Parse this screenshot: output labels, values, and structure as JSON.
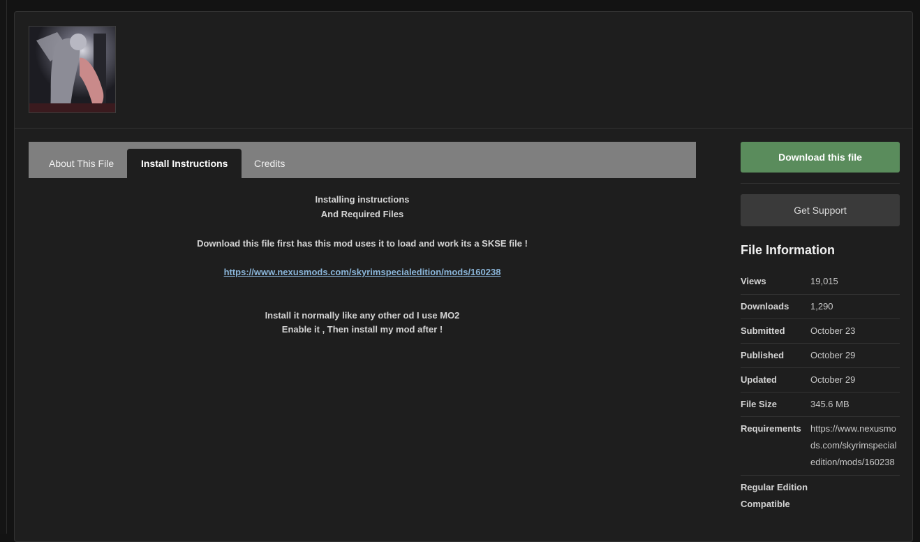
{
  "tabs": {
    "about": "About This File",
    "install": "Install Instructions",
    "credits": "Credits"
  },
  "content": {
    "line1": "Installing instructions",
    "line2": "And Required Files",
    "line3": "Download this file first has this mod uses it to load and work its a SKSE file !",
    "link": "https://www.nexusmods.com/skyrimspecialedition/mods/160238",
    "line4": "Install it normally like any other od  I use MO2",
    "line5": "Enable it , Then install my mod after !"
  },
  "sidebar": {
    "download_label": "Download this file",
    "support_label": "Get Support",
    "file_info_title": "File Information",
    "rows": [
      {
        "key": "Views",
        "value": "19,015"
      },
      {
        "key": "Downloads",
        "value": "1,290"
      },
      {
        "key": "Submitted",
        "value": "October 23"
      },
      {
        "key": "Published",
        "value": "October 29"
      },
      {
        "key": "Updated",
        "value": "October 29"
      },
      {
        "key": "File Size",
        "value": "345.6 MB"
      },
      {
        "key": "Requirements",
        "value": "https://www.nexusmods.com/skyrimspecialedition/mods/160238"
      },
      {
        "key": "Regular Edition Compatible",
        "value": ""
      }
    ]
  },
  "colors": {
    "download_button": "#5a8c5c",
    "link": "#8ab5d9",
    "tab_bar": "#7f7f7f"
  }
}
